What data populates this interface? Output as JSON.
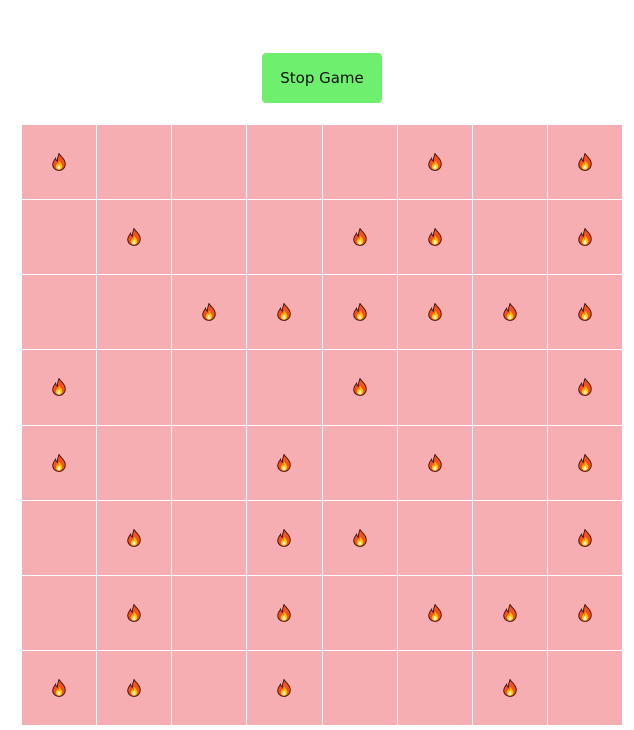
{
  "controls": {
    "stop_label": "Stop Game"
  },
  "board": {
    "rows": 8,
    "cols": 8,
    "cell_color": "#f7aeb2",
    "fire_icon": "fire-icon",
    "cells": [
      [
        1,
        0,
        0,
        0,
        0,
        1,
        0,
        1
      ],
      [
        0,
        1,
        0,
        0,
        1,
        1,
        0,
        1
      ],
      [
        0,
        0,
        1,
        1,
        1,
        1,
        1,
        1
      ],
      [
        1,
        0,
        0,
        0,
        1,
        0,
        0,
        1
      ],
      [
        1,
        0,
        0,
        1,
        0,
        1,
        0,
        1
      ],
      [
        0,
        1,
        0,
        1,
        1,
        0,
        0,
        1
      ],
      [
        0,
        1,
        0,
        1,
        0,
        1,
        1,
        1
      ],
      [
        1,
        1,
        0,
        1,
        0,
        0,
        1,
        0
      ]
    ]
  }
}
